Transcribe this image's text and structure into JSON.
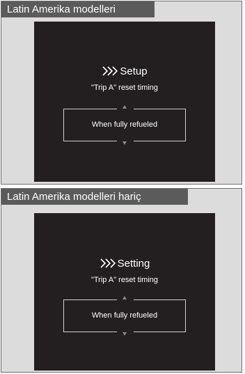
{
  "panels": [
    {
      "header": "Latin Amerika modelleri",
      "screen": {
        "title_icon": "triple-chevron-right-icon",
        "title": "Setup",
        "subtitle": "\"Trip A\" reset timing",
        "option": "When fully refueled"
      }
    },
    {
      "header": "Latin Amerika modelleri hariç",
      "screen": {
        "title_icon": "triple-chevron-right-icon",
        "title": "Setting",
        "subtitle": "\"Trip A\" reset timing",
        "option": "When fully refueled"
      }
    }
  ],
  "colors": {
    "panel_background": "#dcdcdc",
    "header_background": "#5b5b5b",
    "screen_background": "#231f20",
    "text": "#ffffff",
    "arrow": "#8a8a8a"
  }
}
